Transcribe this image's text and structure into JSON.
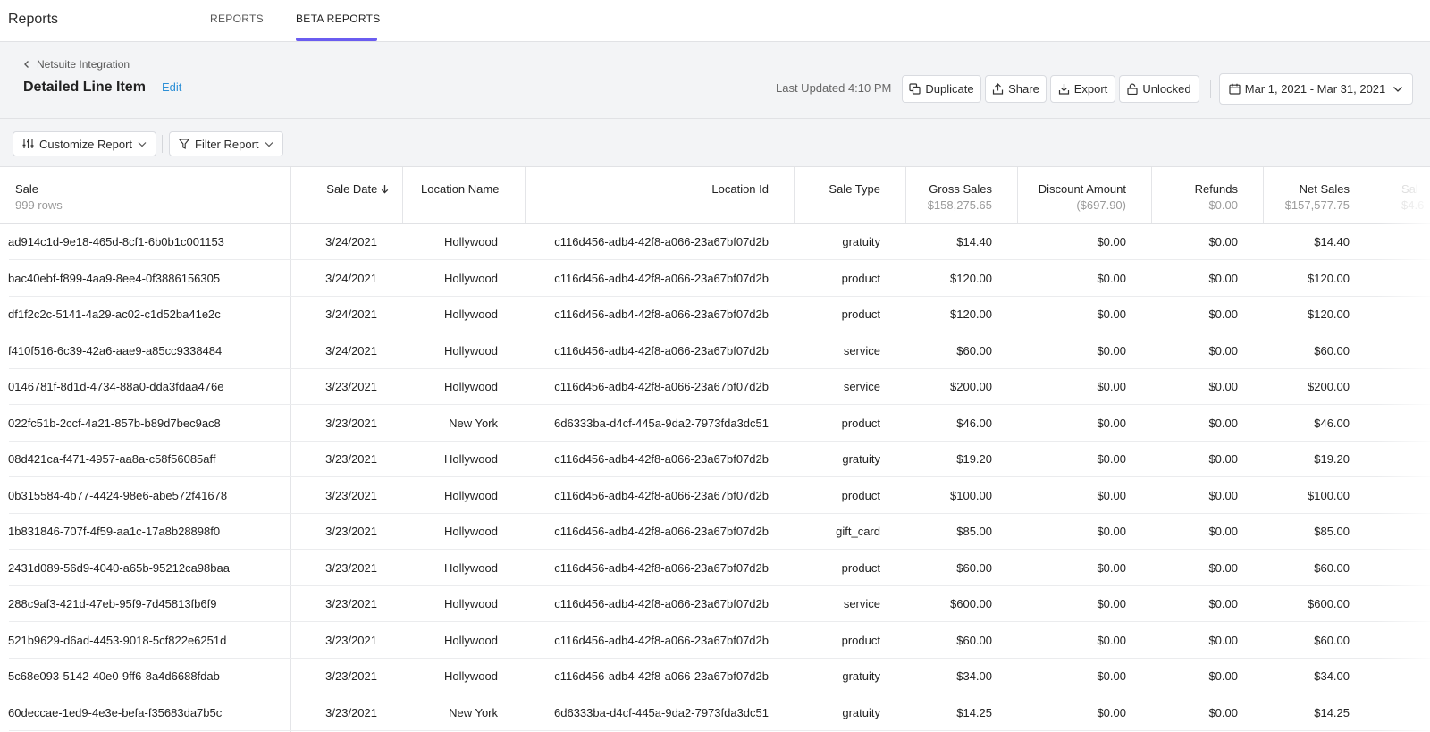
{
  "app": {
    "title": "Reports"
  },
  "tabs": [
    {
      "label": "REPORTS",
      "active": false
    },
    {
      "label": "BETA REPORTS",
      "active": true
    }
  ],
  "header": {
    "breadcrumb": "Netsuite Integration",
    "title": "Detailed Line Item",
    "edit_label": "Edit",
    "last_updated": "Last Updated 4:10 PM",
    "duplicate_label": "Duplicate",
    "share_label": "Share",
    "export_label": "Export",
    "lock_label": "Unlocked",
    "date_range": "Mar 1, 2021 - Mar 31, 2021"
  },
  "toolbar": {
    "customize_label": "Customize Report",
    "filter_label": "Filter Report"
  },
  "table": {
    "columns": [
      {
        "label": "Sale",
        "sub": "999 rows"
      },
      {
        "label": "Sale Date",
        "sub": ""
      },
      {
        "label": "Location Name",
        "sub": ""
      },
      {
        "label": "Location Id",
        "sub": ""
      },
      {
        "label": "Sale Type",
        "sub": ""
      },
      {
        "label": "Gross Sales",
        "sub": "$158,275.65"
      },
      {
        "label": "Discount Amount",
        "sub": "($697.90)"
      },
      {
        "label": "Refunds",
        "sub": "$0.00"
      },
      {
        "label": "Net Sales",
        "sub": "$157,577.75"
      },
      {
        "label": "Sal",
        "sub": "$4.6"
      }
    ],
    "rows": [
      [
        "ad914c1d-9e18-465d-8cf1-6b0b1c001153",
        "3/24/2021",
        "Hollywood",
        "c116d456-adb4-42f8-a066-23a67bf07d2b",
        "gratuity",
        "$14.40",
        "$0.00",
        "$0.00",
        "$14.40"
      ],
      [
        "bac40ebf-f899-4aa9-8ee4-0f3886156305",
        "3/24/2021",
        "Hollywood",
        "c116d456-adb4-42f8-a066-23a67bf07d2b",
        "product",
        "$120.00",
        "$0.00",
        "$0.00",
        "$120.00"
      ],
      [
        "df1f2c2c-5141-4a29-ac02-c1d52ba41e2c",
        "3/24/2021",
        "Hollywood",
        "c116d456-adb4-42f8-a066-23a67bf07d2b",
        "product",
        "$120.00",
        "$0.00",
        "$0.00",
        "$120.00"
      ],
      [
        "f410f516-6c39-42a6-aae9-a85cc9338484",
        "3/24/2021",
        "Hollywood",
        "c116d456-adb4-42f8-a066-23a67bf07d2b",
        "service",
        "$60.00",
        "$0.00",
        "$0.00",
        "$60.00"
      ],
      [
        "0146781f-8d1d-4734-88a0-dda3fdaa476e",
        "3/23/2021",
        "Hollywood",
        "c116d456-adb4-42f8-a066-23a67bf07d2b",
        "service",
        "$200.00",
        "$0.00",
        "$0.00",
        "$200.00"
      ],
      [
        "022fc51b-2ccf-4a21-857b-b89d7bec9ac8",
        "3/23/2021",
        "New York",
        "6d6333ba-d4cf-445a-9da2-7973fda3dc51",
        "product",
        "$46.00",
        "$0.00",
        "$0.00",
        "$46.00"
      ],
      [
        "08d421ca-f471-4957-aa8a-c58f56085aff",
        "3/23/2021",
        "Hollywood",
        "c116d456-adb4-42f8-a066-23a67bf07d2b",
        "gratuity",
        "$19.20",
        "$0.00",
        "$0.00",
        "$19.20"
      ],
      [
        "0b315584-4b77-4424-98e6-abe572f41678",
        "3/23/2021",
        "Hollywood",
        "c116d456-adb4-42f8-a066-23a67bf07d2b",
        "product",
        "$100.00",
        "$0.00",
        "$0.00",
        "$100.00"
      ],
      [
        "1b831846-707f-4f59-aa1c-17a8b28898f0",
        "3/23/2021",
        "Hollywood",
        "c116d456-adb4-42f8-a066-23a67bf07d2b",
        "gift_card",
        "$85.00",
        "$0.00",
        "$0.00",
        "$85.00"
      ],
      [
        "2431d089-56d9-4040-a65b-95212ca98baa",
        "3/23/2021",
        "Hollywood",
        "c116d456-adb4-42f8-a066-23a67bf07d2b",
        "product",
        "$60.00",
        "$0.00",
        "$0.00",
        "$60.00"
      ],
      [
        "288c9af3-421d-47eb-95f9-7d45813fb6f9",
        "3/23/2021",
        "Hollywood",
        "c116d456-adb4-42f8-a066-23a67bf07d2b",
        "service",
        "$600.00",
        "$0.00",
        "$0.00",
        "$600.00"
      ],
      [
        "521b9629-d6ad-4453-9018-5cf822e6251d",
        "3/23/2021",
        "Hollywood",
        "c116d456-adb4-42f8-a066-23a67bf07d2b",
        "product",
        "$60.00",
        "$0.00",
        "$0.00",
        "$60.00"
      ],
      [
        "5c68e093-5142-40e0-9ff6-8a4d6688fdab",
        "3/23/2021",
        "Hollywood",
        "c116d456-adb4-42f8-a066-23a67bf07d2b",
        "gratuity",
        "$34.00",
        "$0.00",
        "$0.00",
        "$34.00"
      ],
      [
        "60deccae-1ed9-4e3e-befa-f35683da7b5c",
        "3/23/2021",
        "New York",
        "6d6333ba-d4cf-445a-9da2-7973fda3dc51",
        "gratuity",
        "$14.25",
        "$0.00",
        "$0.00",
        "$14.25"
      ]
    ]
  },
  "colors": {
    "accent": "#6a5cf0",
    "link": "#2c8fd6",
    "band": "#f3f4f6"
  }
}
